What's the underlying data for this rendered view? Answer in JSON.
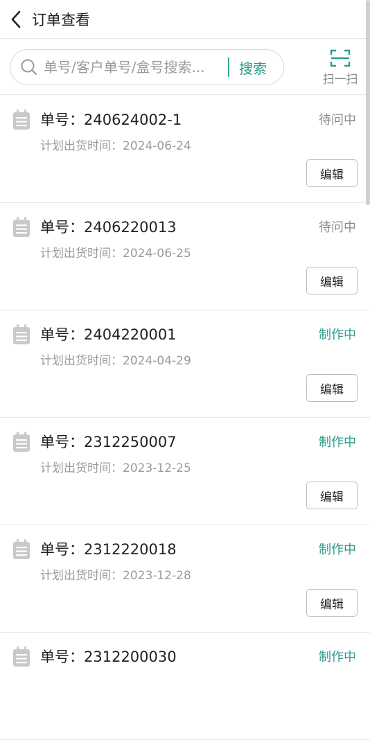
{
  "header": {
    "title": "订单查看",
    "back_icon": "chevron-left-icon"
  },
  "search": {
    "placeholder": "单号/客户单号/盒号搜索...",
    "button_label": "搜索",
    "scan_label": "扫一扫"
  },
  "colors": {
    "accent": "#2f9a8c",
    "status_waiting": "#8c8c8c",
    "divider": "#e6e6e6"
  },
  "orders": [
    {
      "order_no": "单号：240624002-1",
      "ship_date": "计划出货时间：2024-06-24",
      "status": "待问中",
      "status_type": "waiting",
      "edit_label": "编辑"
    },
    {
      "order_no": "单号：2406220013",
      "ship_date": "计划出货时间：2024-06-25",
      "status": "待问中",
      "status_type": "waiting",
      "edit_label": "编辑"
    },
    {
      "order_no": "单号：2404220001",
      "ship_date": "计划出货时间：2024-04-29",
      "status": "制作中",
      "status_type": "making",
      "edit_label": "编辑"
    },
    {
      "order_no": "单号：2312250007",
      "ship_date": "计划出货时间：2023-12-25",
      "status": "制作中",
      "status_type": "making",
      "edit_label": "编辑"
    },
    {
      "order_no": "单号：2312220018",
      "ship_date": "计划出货时间：2023-12-28",
      "status": "制作中",
      "status_type": "making",
      "edit_label": "编辑"
    },
    {
      "order_no": "单号：2312200030",
      "ship_date": "",
      "status": "制作中",
      "status_type": "making",
      "edit_label": ""
    }
  ]
}
